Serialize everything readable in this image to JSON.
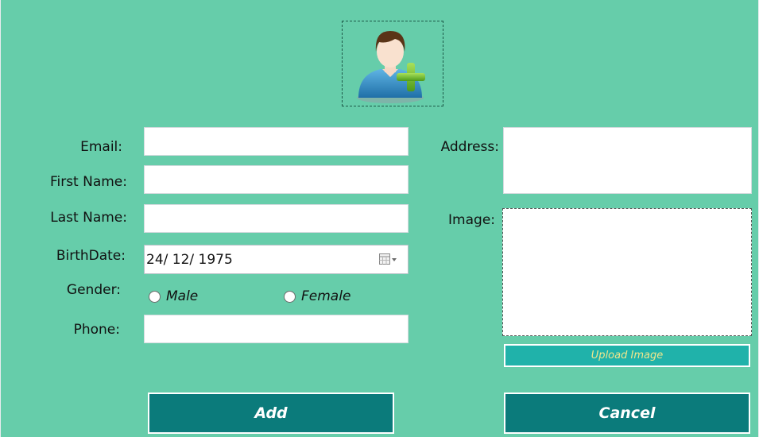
{
  "form": {
    "avatar_icon": "add-user-icon",
    "email": {
      "label": "Email:",
      "value": ""
    },
    "first_name": {
      "label": "First Name:",
      "value": ""
    },
    "last_name": {
      "label": "Last Name:",
      "value": ""
    },
    "birthdate": {
      "label": "BirthDate:",
      "value": "24/ 12/ 1975",
      "icon": "calendar-dropdown-icon"
    },
    "gender": {
      "label": "Gender:",
      "options": [
        "Male",
        "Female"
      ],
      "selected": ""
    },
    "phone": {
      "label": "Phone:",
      "value": ""
    },
    "address": {
      "label": "Address:",
      "value": ""
    },
    "image": {
      "label": "Image:"
    },
    "upload_button": "Upload Image",
    "add_button": "Add",
    "cancel_button": "Cancel"
  },
  "colors": {
    "background": "#66cdaa",
    "button_bg": "#0b7b7b",
    "upload_bg": "#20b2aa",
    "upload_text": "#f0e68c"
  }
}
